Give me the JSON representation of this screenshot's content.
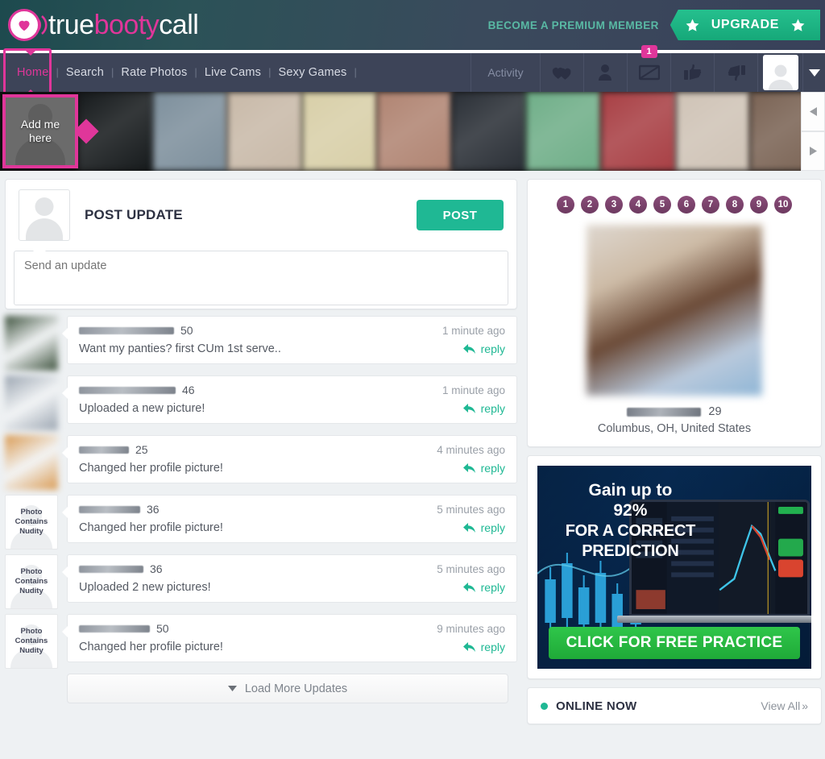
{
  "brand": {
    "part1": "true",
    "part2": "booty",
    "part3": "call",
    "logo_icon": "heart-signal-icon"
  },
  "topbar": {
    "premium_text": "BECOME A PREMIUM MEMBER",
    "upgrade_label": "UPGRADE",
    "star_icon": "star-icon",
    "accent_pink": "#e0369a",
    "accent_green": "#1fb894"
  },
  "nav": {
    "links": [
      {
        "label": "Home",
        "active": true
      },
      {
        "label": "Search",
        "active": false
      },
      {
        "label": "Rate Photos",
        "active": false
      },
      {
        "label": "Live Cams",
        "active": false
      },
      {
        "label": "Sexy Games",
        "active": false
      }
    ],
    "separator": "|",
    "activity_label": "Activity",
    "icons": [
      {
        "name": "hearts-icon",
        "badge": null
      },
      {
        "name": "person-icon",
        "badge": null
      },
      {
        "name": "mail-icon",
        "badge": "1"
      },
      {
        "name": "thumbs-up-icon",
        "badge": null
      },
      {
        "name": "thumbs-down-icon",
        "badge": null
      }
    ],
    "avatar_icon": "user-avatar-icon",
    "caret_icon": "chevron-down-icon"
  },
  "strip": {
    "add_me_line1": "Add me",
    "add_me_line2": "here",
    "prev_icon": "triangle-left-icon",
    "next_icon": "triangle-right-icon",
    "photos": [
      "#161a1c",
      "#7d8f9c",
      "#c8b9a8",
      "#d8cfa8",
      "#b08472",
      "#2a2f36",
      "#6fae88",
      "#a83f44",
      "#cfc3b6",
      "#7a6354"
    ]
  },
  "post_update": {
    "title": "POST UPDATE",
    "button_label": "POST",
    "placeholder": "Send an update",
    "value": "",
    "avatar_icon": "user-avatar-icon"
  },
  "feed": {
    "items": [
      {
        "age": "50",
        "text": "Want my panties? first CUm 1st serve..",
        "time": "1 minute ago",
        "reply_label": "reply",
        "thumb_type": "photo",
        "thumb_color": "#3a4f3a",
        "name_width": 118
      },
      {
        "age": "46",
        "text": "Uploaded a new picture!",
        "time": "1 minute ago",
        "reply_label": "reply",
        "thumb_type": "photo",
        "thumb_color": "#9aa4b0",
        "name_width": 120
      },
      {
        "age": "25",
        "text": "Changed her profile picture!",
        "time": "4 minutes ago",
        "reply_label": "reply",
        "thumb_type": "photo",
        "thumb_color": "#d99a52",
        "name_width": 62
      },
      {
        "age": "36",
        "text": "Changed her profile picture!",
        "time": "5 minutes ago",
        "reply_label": "reply",
        "thumb_type": "nudity",
        "nudity_label": "Photo Contains Nudity",
        "name_width": 76
      },
      {
        "age": "36",
        "text": "Uploaded 2 new pictures!",
        "time": "5 minutes ago",
        "reply_label": "reply",
        "thumb_type": "nudity",
        "nudity_label": "Photo Contains Nudity",
        "name_width": 80
      },
      {
        "age": "50",
        "text": "Changed her profile picture!",
        "time": "9 minutes ago",
        "reply_label": "reply",
        "thumb_type": "nudity",
        "nudity_label": "Photo Contains Nudity",
        "name_width": 88
      }
    ],
    "nudity_line1": "Photo",
    "nudity_line2": "Contains",
    "nudity_line3": "Nudity",
    "load_more_label": "Load More Updates",
    "load_more_icon": "triangle-down-icon",
    "reply_icon": "reply-arrow-icon"
  },
  "spotlight": {
    "pager": [
      "1",
      "2",
      "3",
      "4",
      "5",
      "6",
      "7",
      "8",
      "9",
      "10"
    ],
    "age": "29",
    "location": "Columbus, OH, United States",
    "photo_icon": "profile-photo"
  },
  "ad": {
    "line1a": "Gain up to",
    "line1b": "92%",
    "line2": "FOR A CORRECT",
    "line3": "PREDICTION",
    "cta": "CLICK FOR FREE PRACTICE"
  },
  "online": {
    "label": "ONLINE NOW",
    "view_all": "View All",
    "view_all_chevron": "»",
    "dot_icon": "online-status-dot"
  }
}
